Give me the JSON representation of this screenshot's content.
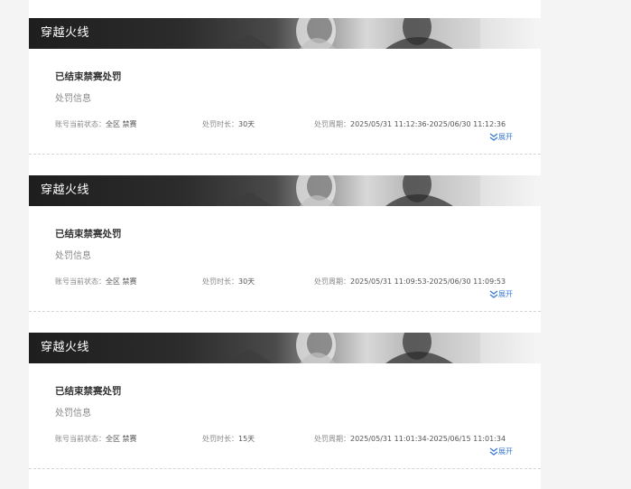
{
  "records": [
    {
      "game_title": "穿越火线",
      "status_title": "已结束禁赛处罚",
      "section_label": "处罚信息",
      "account_status_label": "账号当前状态：",
      "account_status_value": "全区 禁赛",
      "duration_label": "处罚时长：",
      "duration_value": "30天",
      "period_label": "处罚周期：",
      "period_value": "2025/05/31 11:12:36-2025/06/30 11:12:36",
      "expand_label": "展开",
      "expand_icon": "double-chevron-down-icon"
    },
    {
      "game_title": "穿越火线",
      "status_title": "已结束禁赛处罚",
      "section_label": "处罚信息",
      "account_status_label": "账号当前状态：",
      "account_status_value": "全区 禁赛",
      "duration_label": "处罚时长：",
      "duration_value": "30天",
      "period_label": "处罚周期：",
      "period_value": "2025/05/31 11:09:53-2025/06/30 11:09:53",
      "expand_label": "展开",
      "expand_icon": "double-chevron-down-icon"
    },
    {
      "game_title": "穿越火线",
      "status_title": "已结束禁赛处罚",
      "section_label": "处罚信息",
      "account_status_label": "账号当前状态：",
      "account_status_value": "全区 禁赛",
      "duration_label": "处罚时长：",
      "duration_value": "15天",
      "period_label": "处罚周期：",
      "period_value": "2025/05/31 11:01:34-2025/06/15 11:01:34",
      "expand_label": "展开",
      "expand_icon": "double-chevron-down-icon"
    }
  ],
  "colors": {
    "accent_link": "#3a7bd5",
    "banner_dark": "#1e1e1e",
    "title_text": "#333333",
    "muted_text": "#888888"
  }
}
